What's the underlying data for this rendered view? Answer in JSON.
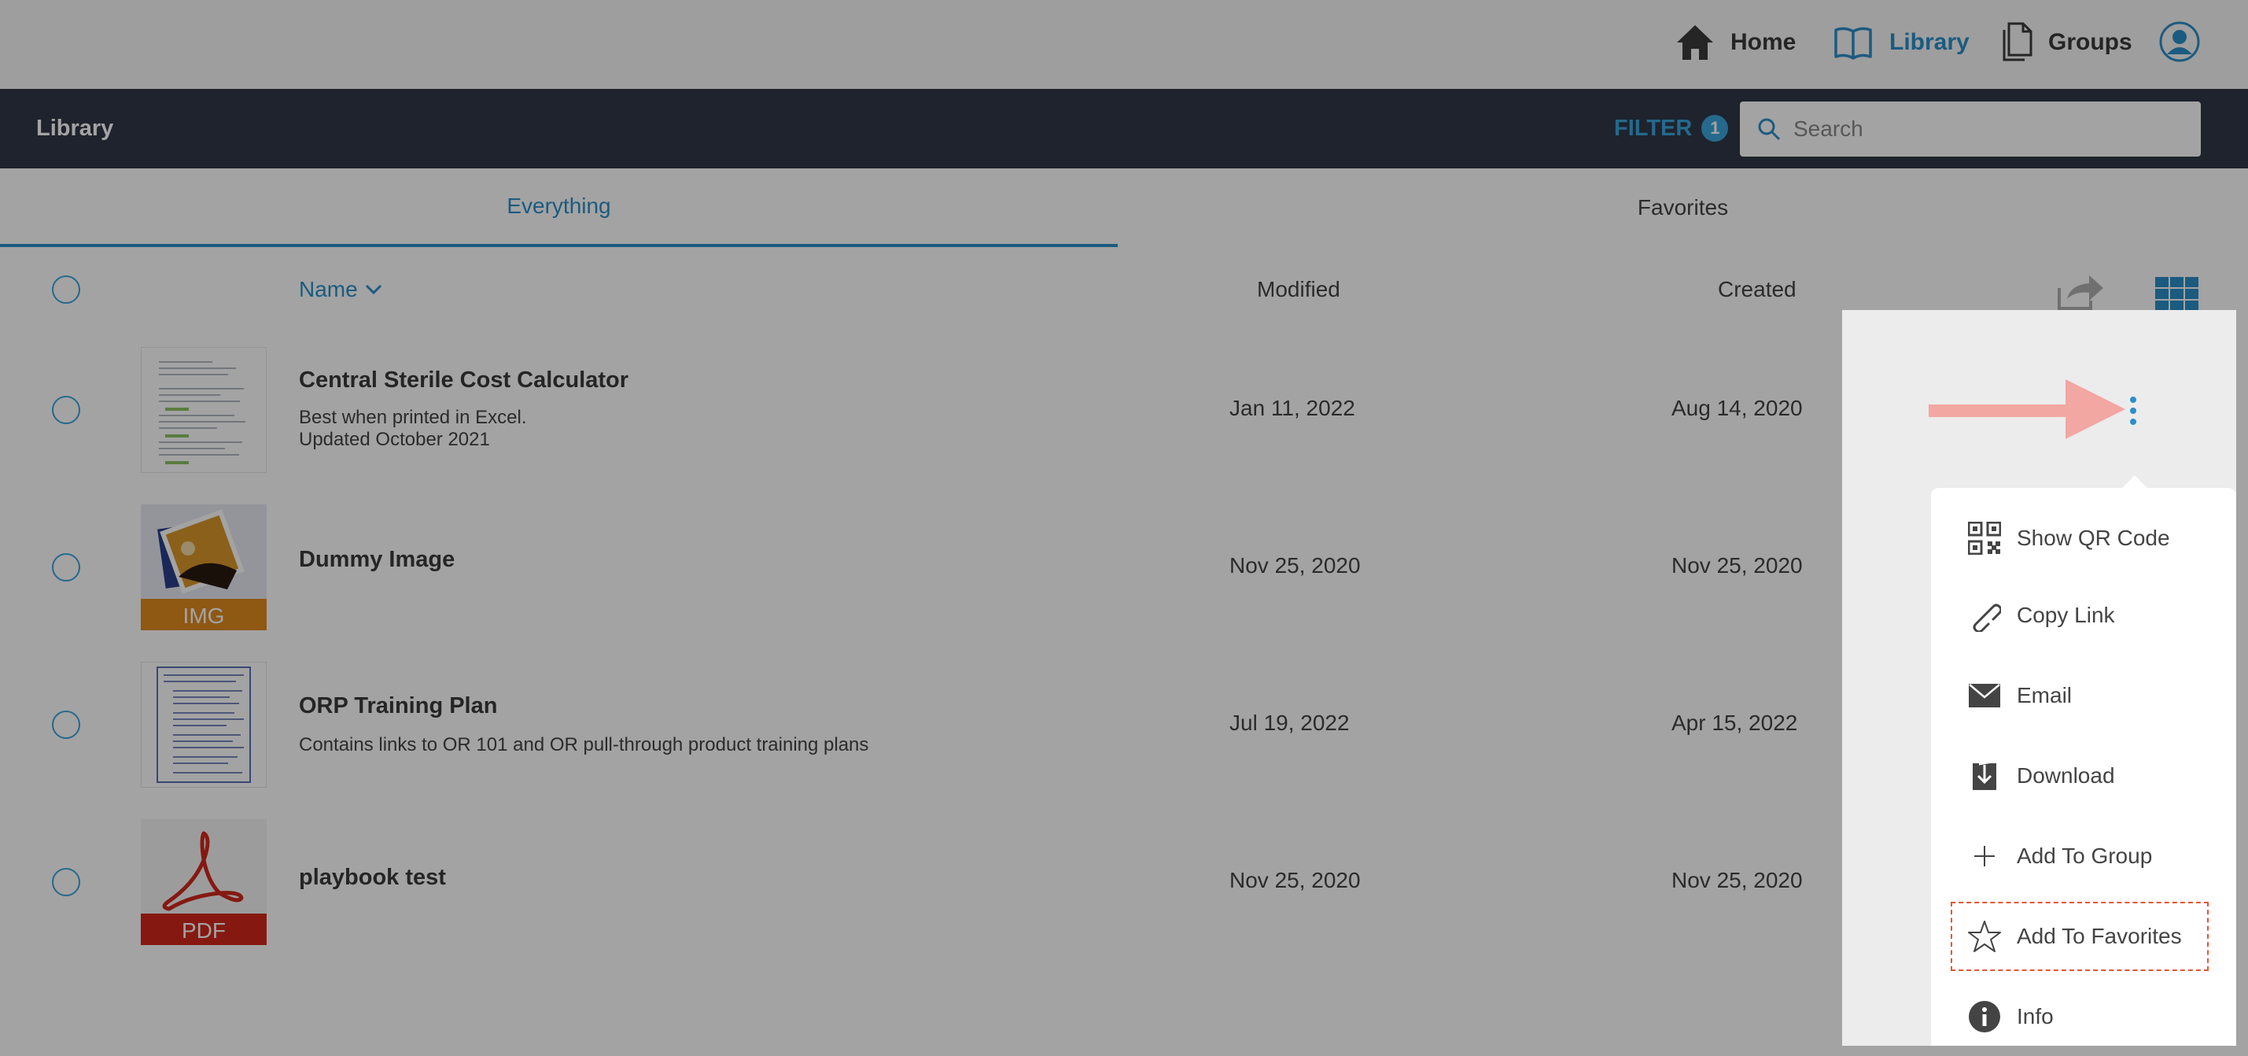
{
  "nav": {
    "home_label": "Home",
    "library_label": "Library",
    "groups_label": "Groups",
    "accent": "#2b8fc9"
  },
  "header": {
    "title": "Library",
    "filter_label": "FILTER",
    "filter_count": "1",
    "search_placeholder": "Search"
  },
  "tabs": [
    {
      "label": "Everything",
      "active": true
    },
    {
      "label": "Favorites",
      "active": false
    }
  ],
  "columns": {
    "name": "Name",
    "modified": "Modified",
    "created": "Created"
  },
  "rows": [
    {
      "title": "Central Sterile Cost Calculator",
      "desc_line1": "Best when printed in Excel.",
      "desc_line2": "Updated October 2021",
      "modified": "Jan 11, 2022",
      "created": "Aug 14, 2020",
      "thumb": "document"
    },
    {
      "title": "Dummy Image",
      "modified": "Nov 25, 2020",
      "created": "Nov 25, 2020",
      "thumb": "image",
      "thumb_label": "IMG"
    },
    {
      "title": "ORP Training Plan",
      "desc_line1": "Contains links to OR 101 and OR pull-through product training plans",
      "modified": "Jul 19, 2022",
      "created": "Apr 15, 2022",
      "thumb": "document"
    },
    {
      "title": "playbook test",
      "modified": "Nov 25, 2020",
      "created": "Nov 25, 2020",
      "thumb": "pdf",
      "thumb_label": "PDF"
    }
  ],
  "context_menu": {
    "items": [
      {
        "label": "Show QR Code",
        "icon": "qr-code-icon"
      },
      {
        "label": "Copy Link",
        "icon": "link-icon"
      },
      {
        "label": "Email",
        "icon": "envelope-icon"
      },
      {
        "label": "Download",
        "icon": "download-icon"
      },
      {
        "label": "Add To Group",
        "icon": "plus-icon"
      },
      {
        "label": "Add To Favorites",
        "icon": "star-icon",
        "highlighted": true
      },
      {
        "label": "Info",
        "icon": "info-icon"
      }
    ]
  }
}
